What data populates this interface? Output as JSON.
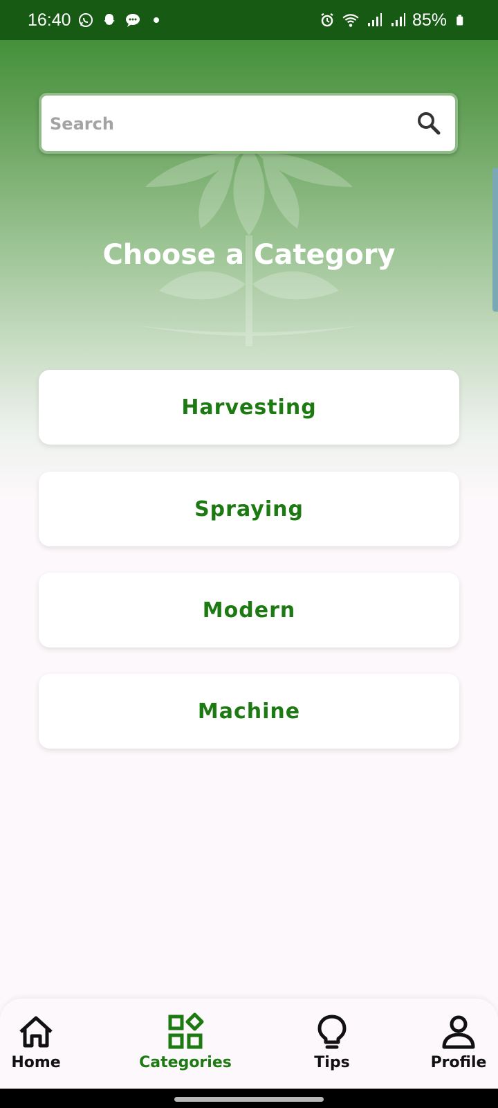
{
  "status_bar": {
    "time": "16:40",
    "battery": "85%",
    "left_icons": [
      "whatsapp-icon",
      "snapchat-icon",
      "message-icon",
      "dot-icon"
    ],
    "right_icons": [
      "alarm-icon",
      "wifi-icon",
      "signal-icon",
      "signal-icon",
      "battery-icon"
    ]
  },
  "search": {
    "placeholder": "Search",
    "value": ""
  },
  "page": {
    "title": "Choose a Category"
  },
  "categories": [
    {
      "label": "Harvesting"
    },
    {
      "label": "Spraying"
    },
    {
      "label": "Modern"
    },
    {
      "label": "Machine"
    }
  ],
  "bottom_nav": {
    "items": [
      {
        "label": "Home",
        "icon": "home-icon"
      },
      {
        "label": "Categories",
        "icon": "categories-icon",
        "active": true
      },
      {
        "label": "Tips",
        "icon": "lightbulb-icon"
      },
      {
        "label": "Profile",
        "icon": "profile-icon"
      }
    ]
  },
  "colors": {
    "primary_green": "#1d7a12",
    "status_bar": "#175a14",
    "card_text": "#1d7a12",
    "background": "#fdf8fb"
  }
}
